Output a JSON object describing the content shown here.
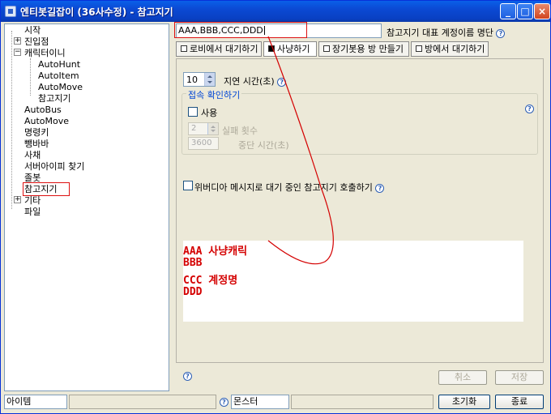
{
  "window": {
    "title": "엔티봇길잡이 (36사수정) - 참고지기",
    "controls": {
      "minimize": "_",
      "maximize": "□",
      "close": "×"
    }
  },
  "tree": {
    "items": [
      {
        "label": "시작"
      },
      {
        "label": "진입점",
        "toggle": "+"
      },
      {
        "label": "캐릭터이니",
        "toggle": "−"
      },
      {
        "label": "AutoHunt"
      },
      {
        "label": "AutoItem"
      },
      {
        "label": "AutoMove"
      },
      {
        "label": "참고지기"
      },
      {
        "label": "AutoBus"
      },
      {
        "label": "AutoMove"
      },
      {
        "label": "명령키"
      },
      {
        "label": "뺑바바"
      },
      {
        "label": "사채"
      },
      {
        "label": "서버아이피 찾기"
      },
      {
        "label": "졸봇"
      },
      {
        "label": "참고지기"
      },
      {
        "label": "기타",
        "toggle": "+"
      },
      {
        "label": "파일"
      }
    ]
  },
  "account": {
    "value": "AAA,BBB,CCC,DDD",
    "label": "참고지기 대표 계정이름 명단"
  },
  "tabs": [
    {
      "label": "로비에서 대기하기",
      "active": false
    },
    {
      "label": "사냥하기",
      "active": true
    },
    {
      "label": "장기봇용 방 만들기",
      "active": false
    },
    {
      "label": "방에서 대기하기",
      "active": false
    }
  ],
  "delay": {
    "value": "10",
    "label": "지연 시간(초)"
  },
  "connect_group": {
    "title": "접속 확인하기",
    "use_label": "사용",
    "fail_count_value": "2",
    "fail_count_label": "실패 횟수",
    "stop_time_value": "3600",
    "stop_time_label": "중단 시간(초)"
  },
  "wib_label": "위버디아 메시지로 대기 중인 참고지기 호출하기",
  "notes": [
    {
      "text": "AAA 사냥캐릭"
    },
    {
      "text": "BBB"
    },
    {
      "text": "CCC 계정명"
    },
    {
      "text": "DDD"
    }
  ],
  "buttons": {
    "cancel": "취소",
    "save": "저장",
    "reset": "초기화",
    "quit": "종료"
  },
  "statusbar": {
    "item_field": "아이템",
    "monster_field": "몬스터"
  },
  "colors": {
    "annotation": "#d40000",
    "titlebar": "#0b49d3",
    "help": "#2d5fb5"
  }
}
